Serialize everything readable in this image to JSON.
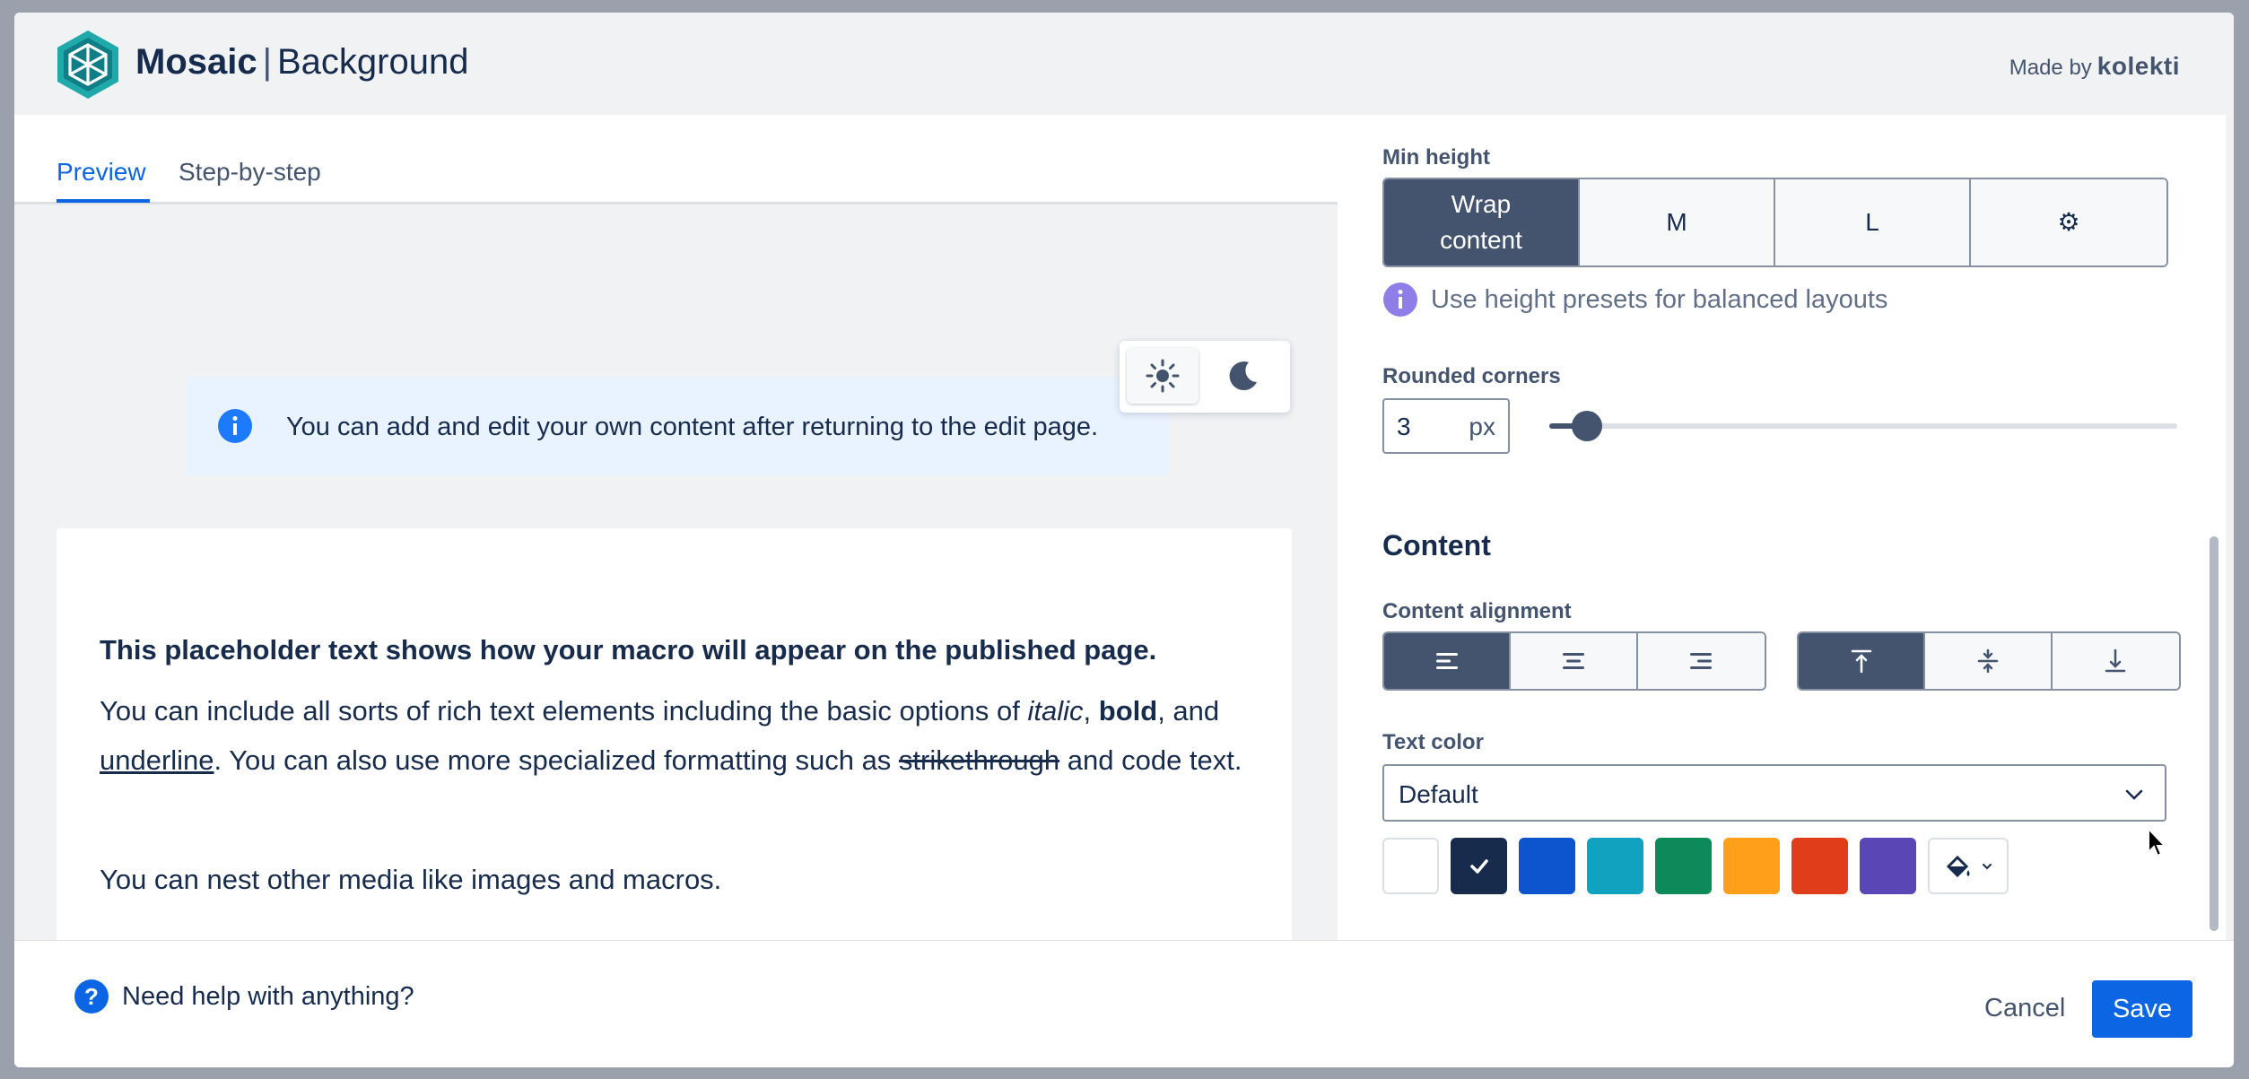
{
  "header": {
    "brand_name": "Mosaic",
    "separator": "|",
    "page_name": "Background",
    "made_by_label": "Made by",
    "made_by_brand": "kolekti"
  },
  "tabs": [
    {
      "label": "Preview",
      "active": true
    },
    {
      "label": "Step-by-step",
      "active": false
    }
  ],
  "theme_toggle": {
    "options": [
      "light",
      "dark"
    ],
    "selected": "light"
  },
  "info_banner": {
    "text": "You can add and edit your own content after returning to the edit page."
  },
  "preview": {
    "heading": "This placeholder text shows how your macro will appear on the published page.",
    "body": {
      "p1": "You can include all sorts of rich text elements including the basic options of ",
      "italic": "italic",
      "comma1": ", ",
      "bold": "bold",
      "p2": ", and ",
      "underline": "underline",
      "p3": ". You can also use more specialized formatting such as ",
      "strike": "strikethrough",
      "p4": " and code text."
    },
    "nest": "You can nest other media like images and macros."
  },
  "settings": {
    "min_height": {
      "label": "Min height",
      "options": [
        "Wrap content",
        "M",
        "L",
        "⚙"
      ],
      "selected": "Wrap content",
      "hint": "Use height presets for balanced layouts"
    },
    "rounded_corners": {
      "label": "Rounded corners",
      "value": "3",
      "unit": "px",
      "slider_fraction": 0.06
    },
    "content": {
      "title": "Content",
      "alignment_label": "Content alignment",
      "horizontal": [
        "left",
        "center",
        "right"
      ],
      "horizontal_selected": "left",
      "vertical": [
        "top",
        "middle",
        "bottom"
      ],
      "vertical_selected": "top"
    },
    "text_color": {
      "label": "Text color",
      "value": "Default",
      "swatches": [
        "#ffffff",
        "#172b4d",
        "#0c55cf",
        "#11a2c0",
        "#0c8a5a",
        "#ff9f1a",
        "#e03e1a",
        "#5a46b5"
      ],
      "selected_index": 1
    }
  },
  "footer": {
    "help_text": "Need help with anything?",
    "cancel_label": "Cancel",
    "save_label": "Save"
  },
  "colors": {
    "primary": "#0c66e4",
    "selected_segment": "#44546f",
    "info_bg": "#e9f2ff",
    "hint_icon": "#8f7ee7"
  }
}
